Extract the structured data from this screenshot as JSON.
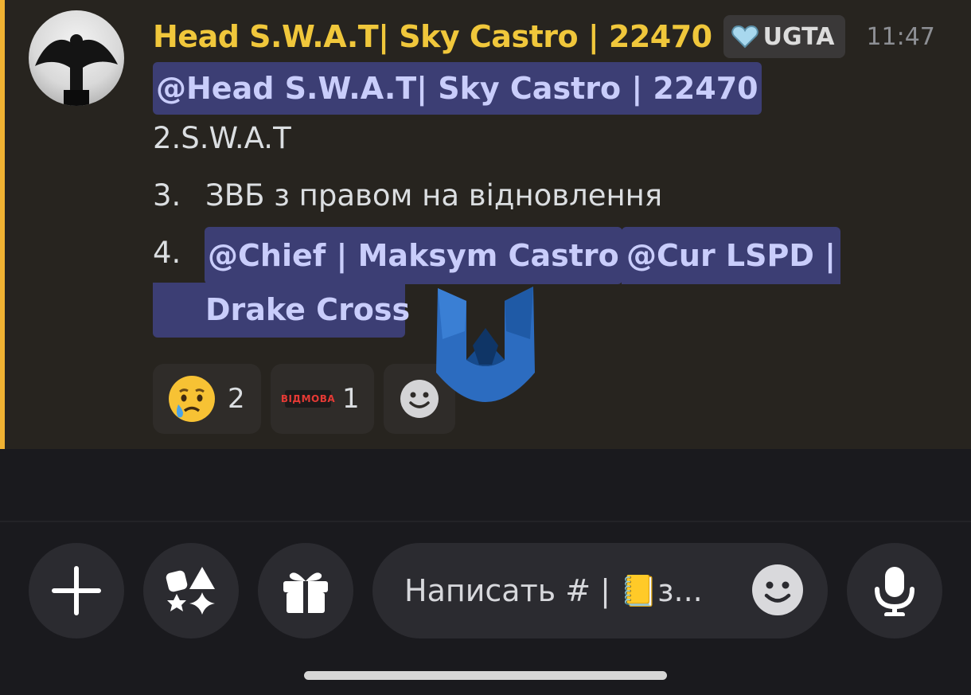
{
  "message": {
    "author": "Head S.W.A.T| Sky Castro | 22470",
    "tag": {
      "icon": "heart-icon",
      "label": "UGTA"
    },
    "time": "11:47",
    "mention_author": "@Head S.W.A.T| Sky Castro | 22470",
    "lines": {
      "line2": "2.S.W.A.T",
      "line3_num": "3.",
      "line3_text": "ЗВБ з правом на відновлення",
      "line4_num": "4."
    },
    "mentions": {
      "chief": "@Chief | Maksym Castro",
      "cur": "@Cur LSPD |",
      "drake": "Drake Cross"
    },
    "reactions": [
      {
        "icon": "crying-face-icon",
        "count": "2"
      },
      {
        "icon": "vidmova-sticker-icon",
        "label": "ВІДМОВА",
        "count": "1"
      },
      {
        "icon": "add-reaction-icon"
      }
    ],
    "accent_color": "#f0b232",
    "author_color": "#f0c73b"
  },
  "composer": {
    "placeholder": "Написать # | 📒з...",
    "buttons": [
      "plus-icon",
      "apps-icon",
      "gift-icon",
      "emoji-icon",
      "mic-icon"
    ]
  }
}
